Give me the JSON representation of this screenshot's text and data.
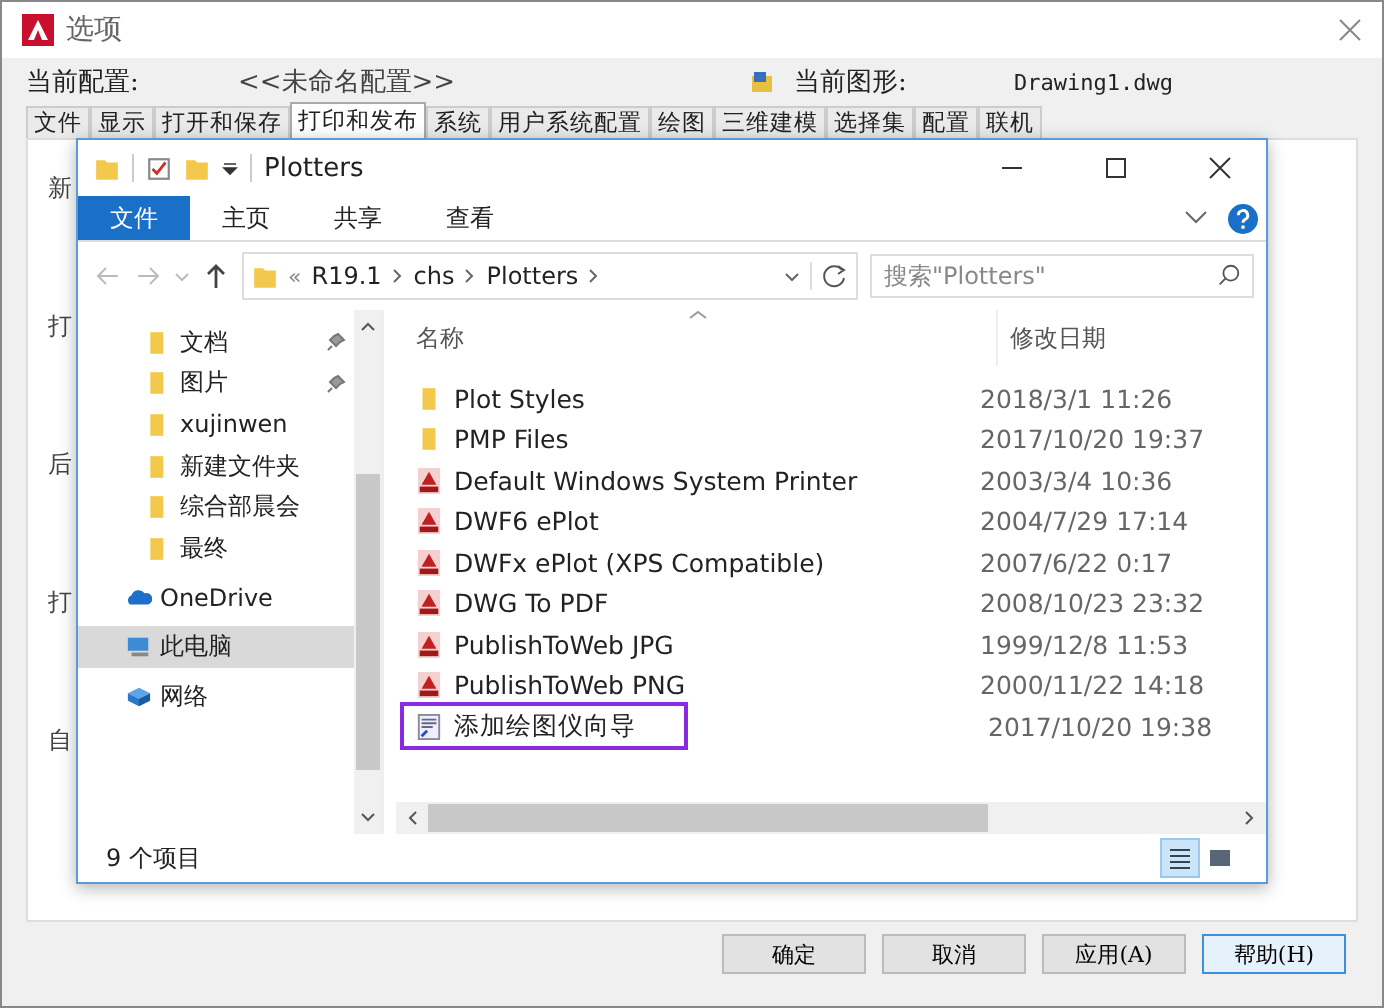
{
  "dialog": {
    "title": "选项",
    "profile_label": "当前配置:",
    "profile_value": "<<未命名配置>>",
    "drawing_label": "当前图形:",
    "drawing_value": "Drawing1.dwg",
    "tabs": [
      {
        "label": "文件",
        "selected": false
      },
      {
        "label": "显示",
        "selected": false
      },
      {
        "label": "打开和保存",
        "selected": false
      },
      {
        "label": "打印和发布",
        "selected": true
      },
      {
        "label": "系统",
        "selected": false
      },
      {
        "label": "用户系统配置",
        "selected": false
      },
      {
        "label": "绘图",
        "selected": false
      },
      {
        "label": "三维建模",
        "selected": false
      },
      {
        "label": "选择集",
        "selected": false
      },
      {
        "label": "配置",
        "selected": false
      },
      {
        "label": "联机",
        "selected": false
      }
    ],
    "group_fragments": [
      "新",
      "打",
      "后",
      "打",
      "自"
    ],
    "buttons": [
      {
        "label": "确定",
        "selected": false
      },
      {
        "label": "取消",
        "selected": false
      },
      {
        "label": "应用(A)",
        "selected": false
      },
      {
        "label": "帮助(H)",
        "selected": true
      }
    ]
  },
  "explorer": {
    "title": "Plotters",
    "ribbon_tabs": [
      {
        "label": "文件",
        "selected": true
      },
      {
        "label": "主页",
        "selected": false
      },
      {
        "label": "共享",
        "selected": false
      },
      {
        "label": "查看",
        "selected": false
      }
    ],
    "breadcrumb": [
      "«",
      "R19.1",
      "chs",
      "Plotters"
    ],
    "search": {
      "placeholder": "搜索\"Plotters\""
    },
    "nav": [
      {
        "label": "文档",
        "kind": "quick",
        "pinned": true,
        "selected": false
      },
      {
        "label": "图片",
        "kind": "quick",
        "pinned": true,
        "selected": false
      },
      {
        "label": "xujinwen",
        "kind": "quick",
        "pinned": false,
        "selected": false
      },
      {
        "label": "新建文件夹",
        "kind": "quick",
        "pinned": false,
        "selected": false
      },
      {
        "label": "综合部晨会",
        "kind": "quick",
        "pinned": false,
        "selected": false
      },
      {
        "label": "最终",
        "kind": "quick",
        "pinned": false,
        "selected": false
      },
      {
        "label": "OneDrive",
        "kind": "cloud",
        "pinned": false,
        "selected": false
      },
      {
        "label": "此电脑",
        "kind": "pc",
        "pinned": false,
        "selected": true
      },
      {
        "label": "网络",
        "kind": "network",
        "pinned": false,
        "selected": false
      }
    ],
    "columns": [
      "名称",
      "修改日期"
    ],
    "files": [
      {
        "name": "Plot Styles",
        "kind": "folder",
        "date": "2018/3/1 11:26",
        "marked": false
      },
      {
        "name": "PMP Files",
        "kind": "folder",
        "date": "2017/10/20 19:37",
        "marked": false
      },
      {
        "name": "Default Windows System Printer",
        "kind": "plotter",
        "date": "2003/3/4 10:36",
        "marked": false
      },
      {
        "name": "DWF6 ePlot",
        "kind": "plotter",
        "date": "2004/7/29 17:14",
        "marked": false
      },
      {
        "name": "DWFx ePlot (XPS Compatible)",
        "kind": "plotter",
        "date": "2007/6/22 0:17",
        "marked": false
      },
      {
        "name": "DWG To PDF",
        "kind": "plotter",
        "date": "2008/10/23 23:32",
        "marked": false
      },
      {
        "name": "PublishToWeb JPG",
        "kind": "plotter",
        "date": "1999/12/8 11:53",
        "marked": false
      },
      {
        "name": "PublishToWeb PNG",
        "kind": "plotter",
        "date": "2000/11/22 14:18",
        "marked": false
      },
      {
        "name": "添加绘图仪向导",
        "kind": "wizard",
        "date": "2017/10/20 19:38",
        "marked": true
      }
    ],
    "status": "9 个项目"
  }
}
